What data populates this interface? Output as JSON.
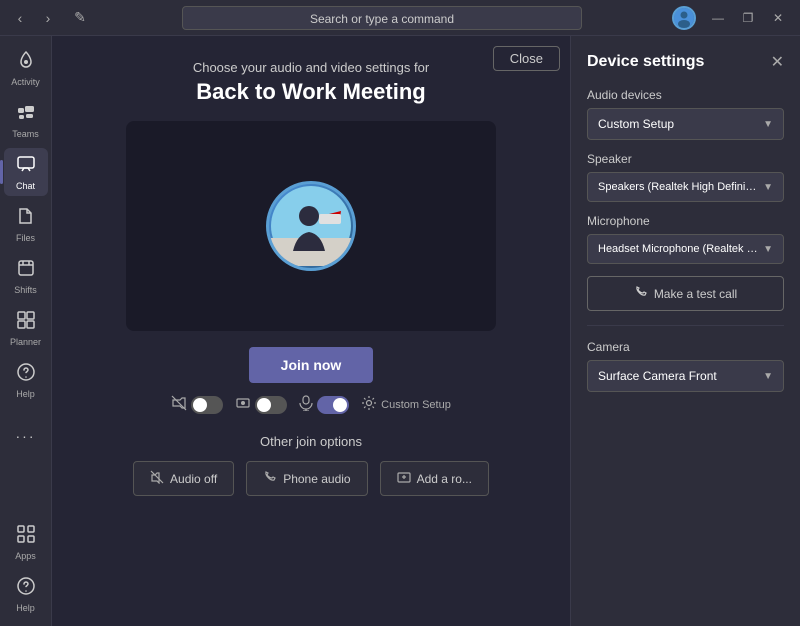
{
  "titlebar": {
    "nav_back": "‹",
    "nav_forward": "›",
    "compose_icon": "✎",
    "search_placeholder": "Search or type a command",
    "window_minimize": "—",
    "window_restore": "❐",
    "window_close": "✕"
  },
  "sidebar": {
    "items": [
      {
        "id": "activity",
        "label": "Activity",
        "icon": "🔔"
      },
      {
        "id": "teams",
        "label": "Teams",
        "icon": "👥"
      },
      {
        "id": "chat",
        "label": "Chat",
        "icon": "💬",
        "active": true
      },
      {
        "id": "files",
        "label": "Files",
        "icon": "📁"
      },
      {
        "id": "shifts",
        "label": "Shifts",
        "icon": "📅"
      },
      {
        "id": "planner",
        "label": "Planner",
        "icon": "📋"
      },
      {
        "id": "help",
        "label": "Help",
        "icon": "❓"
      },
      {
        "id": "more",
        "label": "...",
        "icon": "···"
      }
    ],
    "bottom_items": [
      {
        "id": "apps",
        "label": "Apps",
        "icon": "⊞"
      },
      {
        "id": "help2",
        "label": "Help",
        "icon": "❓"
      }
    ]
  },
  "meeting": {
    "close_label": "Close",
    "subtitle": "Choose your audio and video settings for",
    "title": "Back to Work Meeting",
    "join_label": "Join now",
    "controls": {
      "video_off_icon": "📷",
      "blur_icon": "⬛",
      "mic_icon": "🎤",
      "settings_icon": "⚙",
      "custom_setup_label": "Custom Setup"
    },
    "other_join_title": "Other join options",
    "audio_off_label": "Audio off",
    "phone_audio_label": "Phone audio",
    "add_room_label": "Add a ro..."
  },
  "device_settings": {
    "title": "Device settings",
    "close_icon": "✕",
    "audio_devices_label": "Audio devices",
    "audio_devices_value": "Custom Setup",
    "speaker_label": "Speaker",
    "speaker_value": "Speakers (Realtek High Definition Au...",
    "microphone_label": "Microphone",
    "microphone_value": "Headset Microphone (Realtek High D...",
    "test_call_icon": "📞",
    "test_call_label": "Make a test call",
    "camera_label": "Camera",
    "camera_value": "Surface Camera Front"
  }
}
